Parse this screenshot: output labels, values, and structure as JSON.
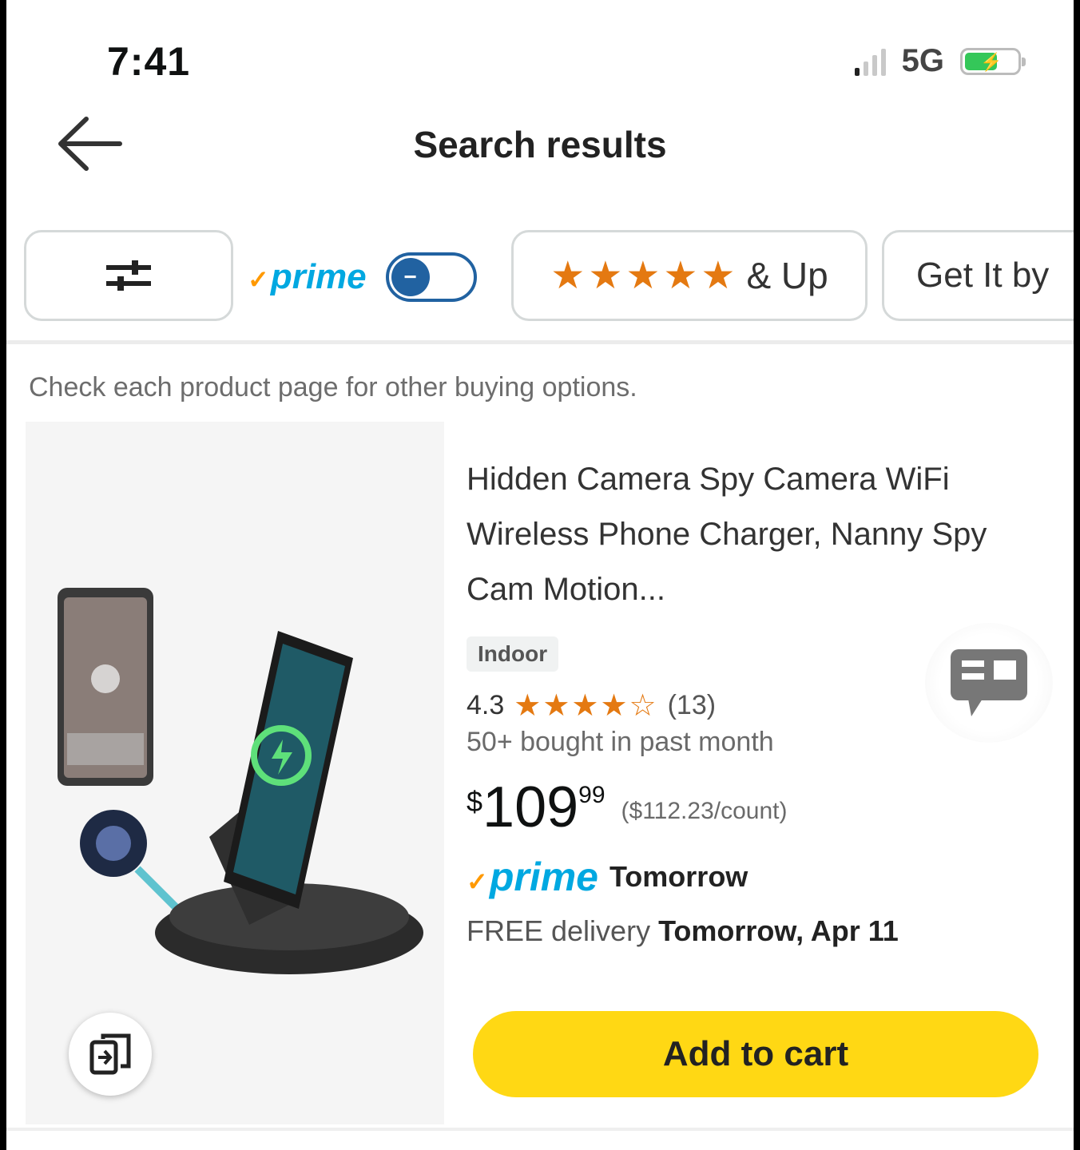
{
  "status_bar": {
    "time": "7:41",
    "network": "5G"
  },
  "header": {
    "title": "Search results"
  },
  "filters": {
    "prime_label": "prime",
    "rating_stars": "★★★★★",
    "rating_label": "& Up",
    "get_it_by": "Get It by"
  },
  "notice": "Check each product page for other buying options.",
  "product": {
    "title": "Hidden Camera Spy Camera WiFi Wireless Phone Charger, Nanny Spy Cam Motion...",
    "tag": "Indoor",
    "rating": "4.3",
    "rating_stars": "★★★★☆",
    "review_count": "(13)",
    "bought": "50+ bought in past month",
    "price_currency": "$",
    "price_whole": "109",
    "price_fraction": "99",
    "price_unit": "($112.23/count)",
    "prime_label": "prime",
    "prime_when": "Tomorrow",
    "delivery_prefix": "FREE delivery",
    "delivery_date": "Tomorrow, Apr 11",
    "add_to_cart": "Add to cart"
  },
  "colors": {
    "accent_yellow": "#ffd814",
    "prime_blue": "#00a8e1",
    "star_orange": "#e47911",
    "toggle_blue": "#2162a1"
  },
  "icons": [
    "back-arrow-icon",
    "filter-sliders-icon",
    "compare-icon",
    "feedback-icon"
  ]
}
